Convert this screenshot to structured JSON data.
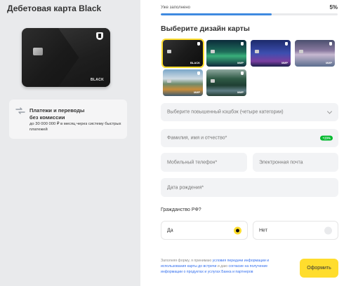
{
  "left_panel": {
    "title": "Дебетовая карта Black",
    "card": {
      "brand": "BLACK"
    },
    "info": {
      "line1": "Платежи и переводы",
      "line2": "без комиссии",
      "line3": "до 30 000 000 ₽ в месяц через систему быстрых платежей"
    }
  },
  "form": {
    "progress": {
      "label": "Уже заполнено",
      "value_text": "5%",
      "value": 5
    },
    "design_title": "Выберите дизайн карты",
    "designs": [
      {
        "name": "black",
        "label": "BLACK",
        "selected": true
      },
      {
        "name": "aurora",
        "label": "МИР",
        "selected": false
      },
      {
        "name": "night-city",
        "label": "МИР",
        "selected": false
      },
      {
        "name": "ice-lake",
        "label": "МИР",
        "selected": false
      },
      {
        "name": "mountain-lake",
        "label": "МИР",
        "selected": false
      },
      {
        "name": "forest-river",
        "label": "МИР",
        "selected": false
      }
    ],
    "cashback_placeholder": "Выберите повышенный кэшбэк (четыре категории)",
    "fio_placeholder": "Фамилия, имя и отчество*",
    "fio_badge": "+20%",
    "phone_placeholder": "Мобильный телефон*",
    "email_placeholder": "Электронная почта",
    "birth_placeholder": "Дата рождения*",
    "citizenship_label": "Гражданство РФ?",
    "citizenship_yes": "Да",
    "citizenship_no": "Нет",
    "legal": {
      "part1": "Заполняя форму, я принимаю ",
      "link1": "условия передачи информации и использования карты до встречи",
      "part2": " и даю ",
      "link2": "согласие на получение информации о продуктах и услугах Банка и партнеров"
    },
    "submit_label": "Оформить"
  },
  "colors": {
    "accent": "#ffdd2d",
    "progress": "#3f8ae0",
    "badge": "#00b92d"
  }
}
